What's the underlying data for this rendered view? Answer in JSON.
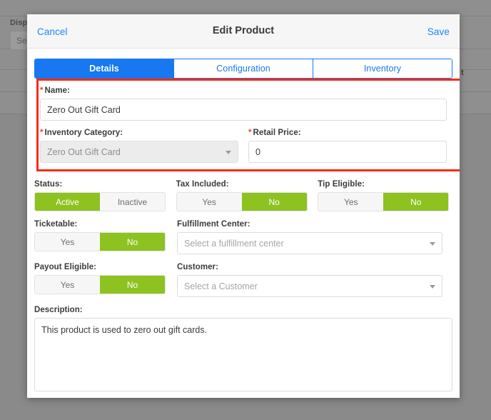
{
  "background": {
    "field_label": "Display",
    "field_value": "Select",
    "edge_mark": "t"
  },
  "modal": {
    "header": {
      "cancel_label": "Cancel",
      "title": "Edit Product",
      "save_label": "Save"
    },
    "tabs": [
      {
        "label": "Details",
        "active": true
      },
      {
        "label": "Configuration",
        "active": false
      },
      {
        "label": "Inventory",
        "active": false
      }
    ],
    "fields": {
      "name": {
        "label": "Name:",
        "required": true,
        "value": "Zero Out Gift Card",
        "placeholder": ""
      },
      "inventory_category": {
        "label": "Inventory Category:",
        "required": true,
        "value": "Zero Out Gift Card",
        "disabled": true
      },
      "retail_price": {
        "label": "Retail Price:",
        "required": true,
        "value": "0",
        "placeholder": ""
      },
      "status": {
        "label": "Status:",
        "options": [
          "Active",
          "Inactive"
        ],
        "selected": "Active"
      },
      "tax_included": {
        "label": "Tax Included:",
        "options": [
          "Yes",
          "No"
        ],
        "selected": "No"
      },
      "tip_eligible": {
        "label": "Tip Eligible:",
        "options": [
          "Yes",
          "No"
        ],
        "selected": "No"
      },
      "ticketable": {
        "label": "Ticketable:",
        "options": [
          "Yes",
          "No"
        ],
        "selected": "No"
      },
      "fulfillment_center": {
        "label": "Fulfillment Center:",
        "value": "",
        "placeholder": "Select a fulfillment center"
      },
      "payout_eligible": {
        "label": "Payout Eligible:",
        "options": [
          "Yes",
          "No"
        ],
        "selected": "No"
      },
      "customer": {
        "label": "Customer:",
        "value": "",
        "placeholder": "Select a Customer"
      },
      "description": {
        "label": "Description:",
        "value": "This product is used to zero out gift cards.",
        "placeholder": ""
      }
    }
  },
  "colors": {
    "accent_blue": "#1778f2",
    "toggle_green": "#8dc220",
    "required_red": "#e8422e",
    "highlight_red": "#fb2a16",
    "backdrop": "#8a8a8a"
  }
}
